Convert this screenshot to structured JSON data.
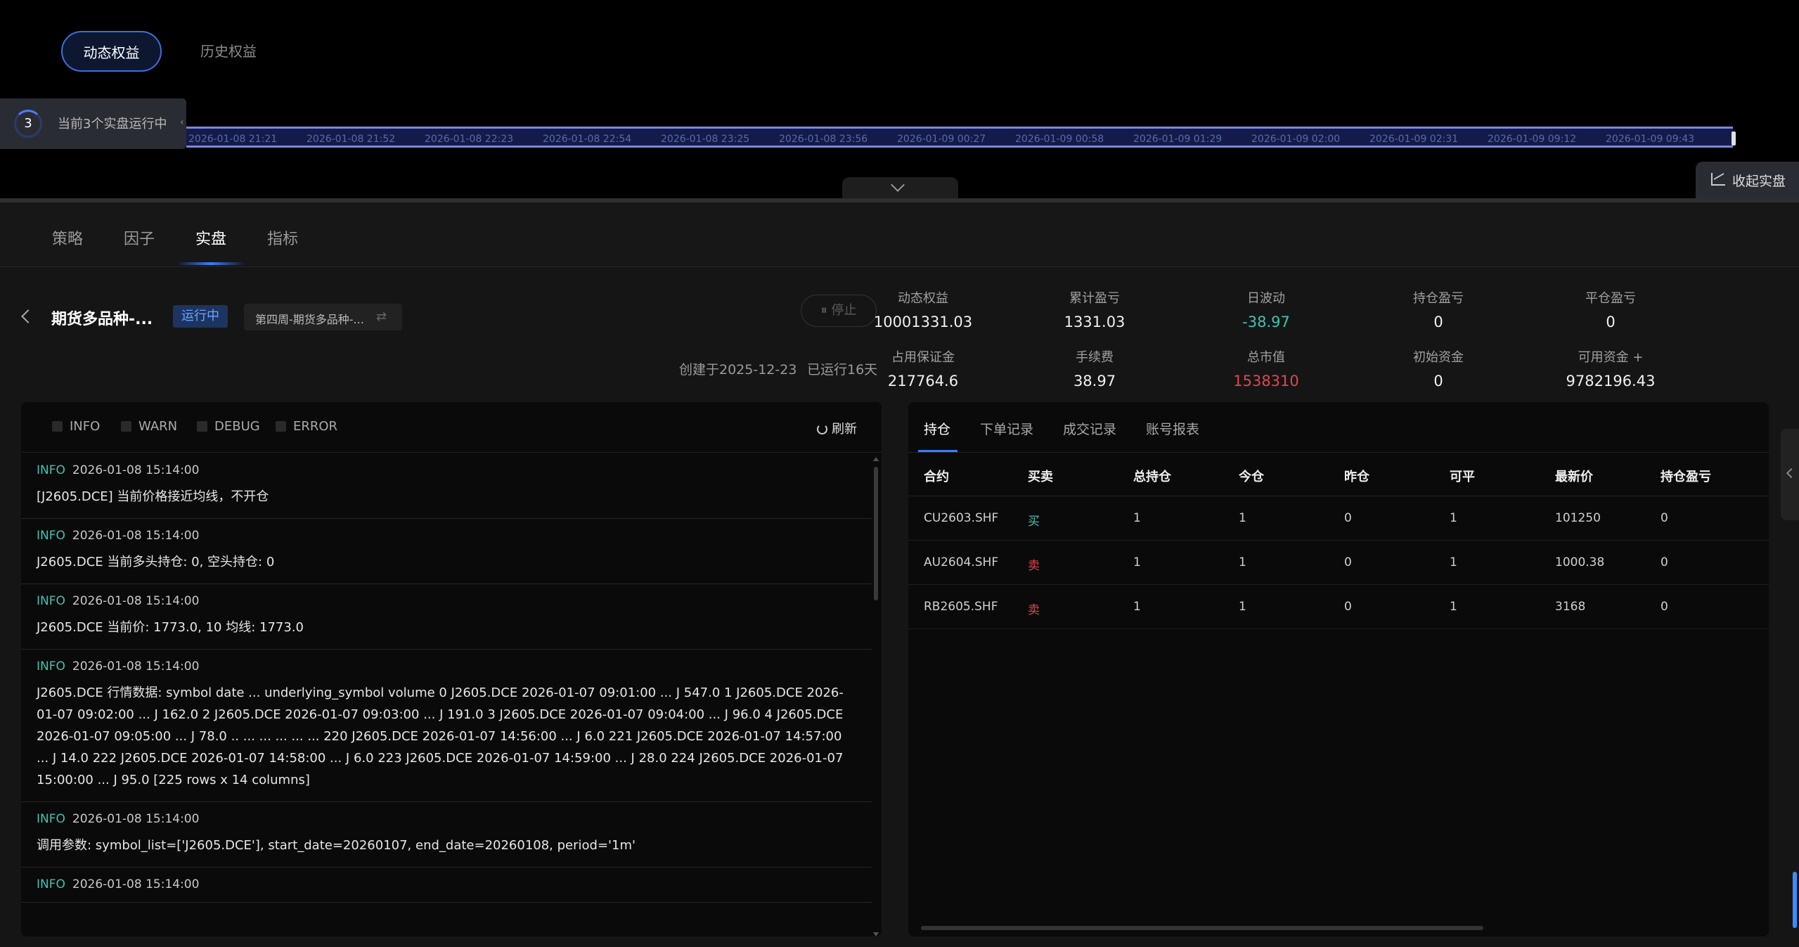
{
  "top_tabs": {
    "active": "动态权益",
    "inactive": "历史权益"
  },
  "running": {
    "count": "3",
    "text": "当前3个实盘运行中"
  },
  "timeline_ticks": [
    "2026-01-08 21:21",
    "2026-01-08 21:52",
    "2026-01-08 22:23",
    "2026-01-08 22:54",
    "2026-01-08 23:25",
    "2026-01-08 23:56",
    "2026-01-09 00:27",
    "2026-01-09 00:58",
    "2026-01-09 01:29",
    "2026-01-09 02:00",
    "2026-01-09 02:31",
    "2026-01-09 09:12",
    "2026-01-09 09:43"
  ],
  "fold_label": "收起实盘",
  "nav": {
    "tabs": [
      "策略",
      "因子",
      "实盘",
      "指标"
    ],
    "active_index": 2
  },
  "strategy": {
    "name": "期货多品种-...",
    "status": "运行中",
    "sub_select": "第四周-期货多品种-...",
    "stop_label": "停止",
    "created": "创建于2025-12-23",
    "running_days": "已运行16天"
  },
  "stats": [
    {
      "label": "动态权益",
      "value": "10001331.03",
      "tone": "normal"
    },
    {
      "label": "累计盈亏",
      "value": "1331.03",
      "tone": "normal"
    },
    {
      "label": "日波动",
      "value": "-38.97",
      "tone": "teal"
    },
    {
      "label": "持仓盈亏",
      "value": "0",
      "tone": "normal"
    },
    {
      "label": "平仓盈亏",
      "value": "0",
      "tone": "normal"
    },
    {
      "label": "占用保证金",
      "value": "217764.6",
      "tone": "normal"
    },
    {
      "label": "手续费",
      "value": "38.97",
      "tone": "normal"
    },
    {
      "label": "总市值",
      "value": "1538310",
      "tone": "red"
    },
    {
      "label": "初始资金",
      "value": "0",
      "tone": "normal"
    },
    {
      "label": "可用资金 +",
      "value": "9782196.43",
      "tone": "normal"
    }
  ],
  "log": {
    "levels": [
      "INFO",
      "WARN",
      "DEBUG",
      "ERROR"
    ],
    "refresh_label": "刷新",
    "entries": [
      {
        "level": "INFO",
        "time": "2026-01-08 15:14:00",
        "msg": "[J2605.DCE] 当前价格接近均线，不开仓"
      },
      {
        "level": "INFO",
        "time": "2026-01-08 15:14:00",
        "msg": "J2605.DCE 当前多头持仓: 0, 空头持仓: 0"
      },
      {
        "level": "INFO",
        "time": "2026-01-08 15:14:00",
        "msg": "J2605.DCE 当前价: 1773.0, 10 均线: 1773.0"
      },
      {
        "level": "INFO",
        "time": "2026-01-08 15:14:00",
        "msg": "J2605.DCE 行情数据: symbol date ... underlying_symbol volume 0 J2605.DCE 2026-01-07 09:01:00 ... J 547.0 1 J2605.DCE 2026-01-07 09:02:00 ... J 162.0 2 J2605.DCE 2026-01-07 09:03:00 ... J 191.0 3 J2605.DCE 2026-01-07 09:04:00 ... J 96.0 4 J2605.DCE 2026-01-07 09:05:00 ... J 78.0 .. ... ... ... ... ... 220 J2605.DCE 2026-01-07 14:56:00 ... J 6.0 221 J2605.DCE 2026-01-07 14:57:00 ... J 14.0 222 J2605.DCE 2026-01-07 14:58:00 ... J 6.0 223 J2605.DCE 2026-01-07 14:59:00 ... J 28.0 224 J2605.DCE 2026-01-07 15:00:00 ... J 95.0 [225 rows x 14 columns]"
      },
      {
        "level": "INFO",
        "time": "2026-01-08 15:14:00",
        "msg": "调用参数: symbol_list=['J2605.DCE'], start_date=20260107, end_date=20260108, period='1m'"
      },
      {
        "level": "INFO",
        "time": "2026-01-08 15:14:00",
        "msg": ""
      }
    ]
  },
  "positions": {
    "tabs": [
      "持仓",
      "下单记录",
      "成交记录",
      "账号报表"
    ],
    "columns": [
      "合约",
      "买卖",
      "总持仓",
      "今仓",
      "昨仓",
      "可平",
      "最新价",
      "持仓盈亏"
    ],
    "rows": [
      [
        "CU2603.SHF",
        "买",
        "1",
        "1",
        "0",
        "1",
        "101250",
        "0"
      ],
      [
        "AU2604.SHF",
        "卖",
        "1",
        "1",
        "0",
        "1",
        "1000.38",
        "0"
      ],
      [
        "RB2605.SHF",
        "卖",
        "1",
        "1",
        "0",
        "1",
        "3168",
        "0"
      ]
    ]
  }
}
